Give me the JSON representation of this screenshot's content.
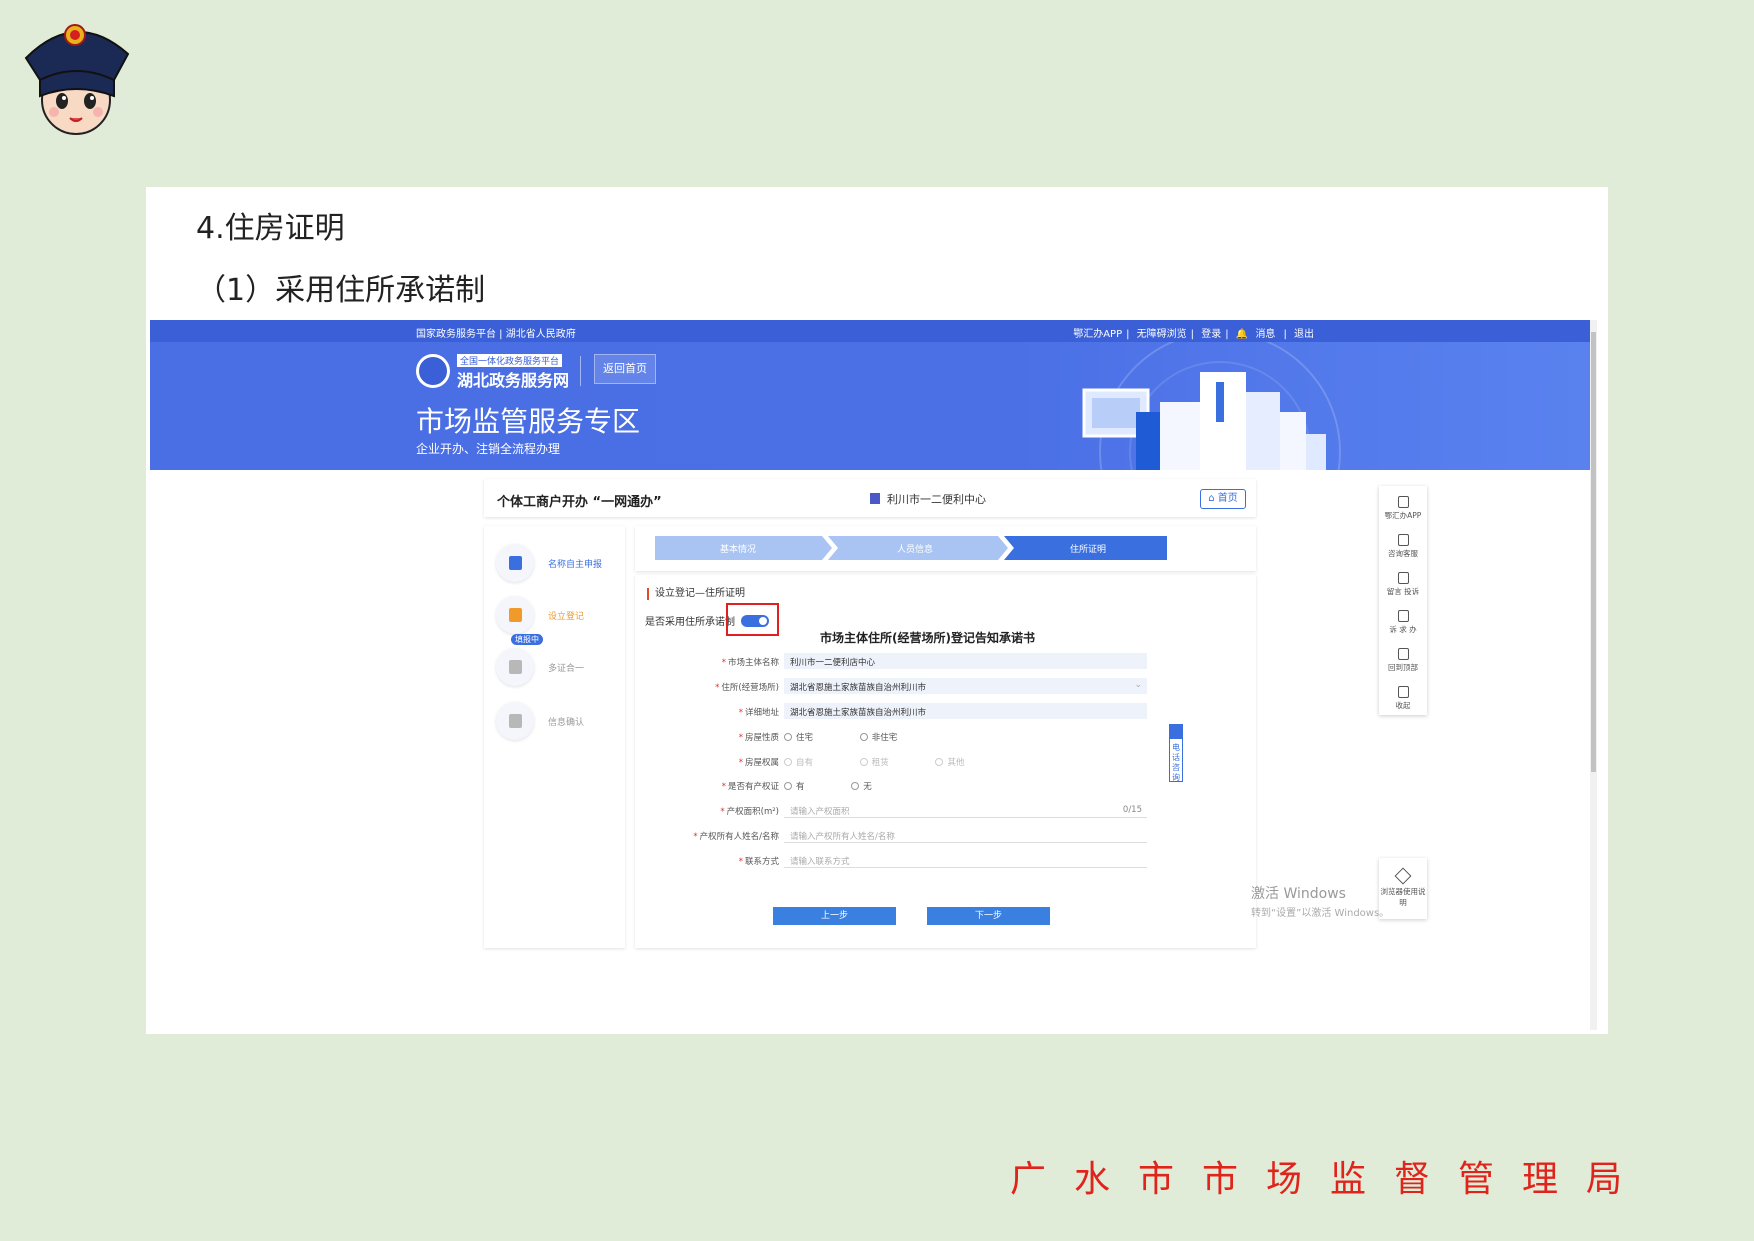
{
  "slide": {
    "heading": "4.住房证明",
    "subheading": "（1）采用住所承诺制",
    "footer": "广水市市场监督管理局"
  },
  "portal": {
    "topbar_left": "国家政务服务平台 | 湖北省人民政府",
    "topbar_right": [
      "鄂汇办APP",
      "无障碍浏览",
      "登录",
      "消息",
      "退出"
    ],
    "logo_tag": "全国一体化政务服务平台",
    "logo_name": "湖北政务服务网",
    "back_home": "返回首页",
    "banner_title": "市场监管服务专区",
    "banner_subtitle": "企业开办、注销全流程办理"
  },
  "page": {
    "title": "个体工商户开办 “一网通办”",
    "center": "利川市一二便利中心",
    "home_button": "首页"
  },
  "sidebar": {
    "items": [
      {
        "label": "名称自主申报",
        "icon": "document-icon"
      },
      {
        "label": "设立登记",
        "icon": "edit-icon",
        "badge": "填报中"
      },
      {
        "label": "多证合一",
        "icon": "id-card-icon"
      },
      {
        "label": "信息确认",
        "icon": "file-check-icon"
      }
    ]
  },
  "steps": [
    "基本情况",
    "人员信息",
    "住所证明"
  ],
  "form": {
    "section_title": "设立登记—住所证明",
    "toggle_label": "是否采用住所承诺制",
    "toggle_on": true,
    "doc_title": "市场主体住所(经营场所)登记告知承诺书",
    "fields": [
      {
        "label": "市场主体名称",
        "value": "利川市一二便利店中心",
        "type": "fill"
      },
      {
        "label": "住所(经营场所)",
        "value": "湖北省恩施土家族苗族自治州利川市",
        "type": "select"
      },
      {
        "label": "详细地址",
        "value": "湖北省恩施土家族苗族自治州利川市",
        "type": "fill"
      },
      {
        "label": "房屋性质",
        "options": [
          "住宅",
          "非住宅"
        ],
        "type": "radio"
      },
      {
        "label": "房屋权属",
        "options": [
          "自有",
          "租赁",
          "其他"
        ],
        "type": "radio-disabled"
      },
      {
        "label": "是否有产权证",
        "options": [
          "有",
          "无"
        ],
        "type": "radio"
      },
      {
        "label": "产权面积(m²)",
        "placeholder": "请输入产权面积",
        "counter": "0/15",
        "type": "line"
      },
      {
        "label": "产权所有人姓名/名称",
        "placeholder": "请输入产权所有人姓名/名称",
        "type": "line"
      },
      {
        "label": "联系方式",
        "placeholder": "请输入联系方式",
        "type": "line"
      }
    ],
    "prev_button": "上一步",
    "next_button": "下一步"
  },
  "float_panel": [
    "鄂汇办APP",
    "咨询客服",
    "留言 投诉",
    "诉 求 办",
    "回到顶部",
    "收起"
  ],
  "float_panel2": "浏览器使用说明",
  "consult": "电话咨询",
  "watermark": {
    "line1": "激活 Windows",
    "line2": "转到“设置”以激活 Windows。"
  },
  "colors": {
    "brand_blue": "#3a5fd6",
    "accent_red": "#e0241c",
    "step_active": "#3a6fe0",
    "step_inactive": "#a9c4f2",
    "background": "#e1ecd8"
  }
}
